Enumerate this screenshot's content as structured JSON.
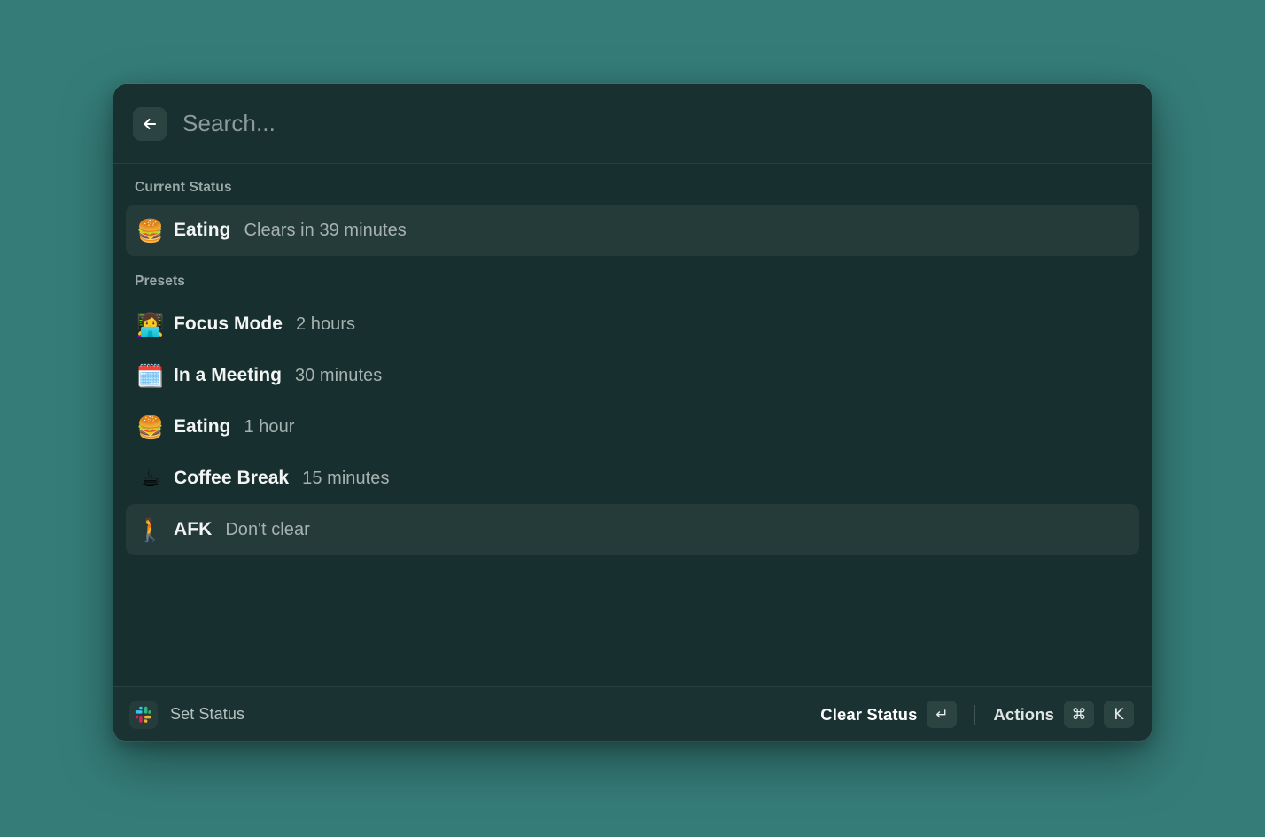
{
  "window": {
    "background_color": "#357c78",
    "panel_color": "#172f2e",
    "accent_selected_color": "#2d4442"
  },
  "search": {
    "placeholder": "Search...",
    "value": "",
    "back_icon": "arrow-left-icon"
  },
  "sections": [
    {
      "id": "current-status",
      "label": "Current Status",
      "items": [
        {
          "emoji": "🍔",
          "emoji_name": "hamburger-emoji",
          "title": "Eating",
          "subtitle": "Clears in 39 minutes",
          "selected": true
        }
      ]
    },
    {
      "id": "presets",
      "label": "Presets",
      "items": [
        {
          "emoji": "👩‍💻",
          "emoji_name": "technologist-emoji",
          "title": "Focus Mode",
          "subtitle": "2 hours",
          "selected": false
        },
        {
          "emoji": "🗓️",
          "emoji_name": "spiral-calendar-emoji",
          "title": "In a Meeting",
          "subtitle": "30 minutes",
          "selected": false
        },
        {
          "emoji": "🍔",
          "emoji_name": "hamburger-emoji",
          "title": "Eating",
          "subtitle": "1 hour",
          "selected": false
        },
        {
          "emoji": "☕",
          "emoji_name": "hot-beverage-emoji",
          "title": "Coffee Break",
          "subtitle": "15 minutes",
          "selected": false
        },
        {
          "emoji": "🚶",
          "emoji_name": "person-walking-emoji",
          "title": "AFK",
          "subtitle": "Don't clear",
          "selected": true
        }
      ]
    }
  ],
  "footer": {
    "app_icon": "slack-icon",
    "app_name": "Set Status",
    "primary_action": "Clear Status",
    "primary_key": "↵",
    "secondary_action": "Actions",
    "secondary_keys": [
      "⌘",
      "K"
    ]
  }
}
